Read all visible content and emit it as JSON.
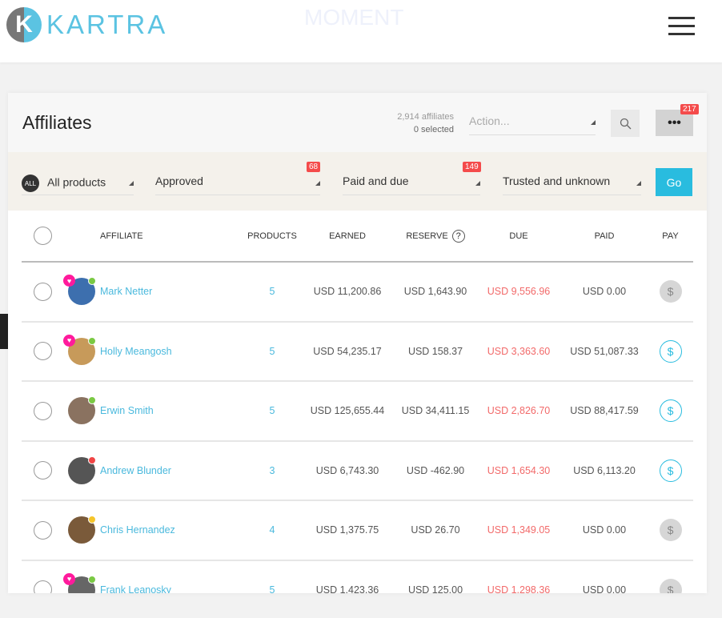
{
  "brand": {
    "logo_letter": "K",
    "logo_text": "KARTRA",
    "moment": "MOMENT"
  },
  "header": {
    "title": "Affiliates",
    "affiliate_count": "2,914 affiliates",
    "selected_count": "0 selected",
    "action_placeholder": "Action...",
    "more_label": "•••",
    "more_badge": "217"
  },
  "filters": {
    "all_badge": "ALL",
    "products": "All products",
    "status": "Approved",
    "status_badge": "68",
    "payment": "Paid and due",
    "payment_badge": "149",
    "trust": "Trusted and unknown",
    "go": "Go"
  },
  "table": {
    "columns": [
      "AFFILIATE",
      "PRODUCTS",
      "EARNED",
      "RESERVE",
      "DUE",
      "PAID",
      "PAY"
    ],
    "reserve_help": "?",
    "rows": [
      {
        "name": "Mark Netter",
        "products": "5",
        "earned": "USD 11,200.86",
        "reserve": "USD 1,643.90",
        "due": "USD 9,556.96",
        "paid": "USD 0.00",
        "pay_enabled": false,
        "heart": true,
        "status": "#7ac943",
        "avatar": "#3d6fae"
      },
      {
        "name": "Holly Meangosh",
        "products": "5",
        "earned": "USD 54,235.17",
        "reserve": "USD 158.37",
        "due": "USD 3,363.60",
        "paid": "USD 51,087.33",
        "pay_enabled": true,
        "heart": true,
        "status": "#7ac943",
        "avatar": "#c79a5a"
      },
      {
        "name": "Erwin Smith",
        "products": "5",
        "earned": "USD 125,655.44",
        "reserve": "USD 34,411.15",
        "due": "USD 2,826.70",
        "paid": "USD 88,417.59",
        "pay_enabled": true,
        "heart": false,
        "status": "#7ac943",
        "avatar": "#8a7260"
      },
      {
        "name": "Andrew Blunder",
        "products": "3",
        "earned": "USD 6,743.30",
        "reserve": "USD -462.90",
        "due": "USD 1,654.30",
        "paid": "USD 6,113.20",
        "pay_enabled": true,
        "heart": false,
        "status": "#f04545",
        "avatar": "#555"
      },
      {
        "name": "Chris Hernandez",
        "products": "4",
        "earned": "USD 1,375.75",
        "reserve": "USD 26.70",
        "due": "USD 1,349.05",
        "paid": "USD 0.00",
        "pay_enabled": false,
        "heart": false,
        "status": "#f5c52a",
        "avatar": "#7a5a3a"
      },
      {
        "name": "Frank Leanosky",
        "products": "5",
        "earned": "USD 1,423.36",
        "reserve": "USD 125.00",
        "due": "USD 1,298.36",
        "paid": "USD 0.00",
        "pay_enabled": false,
        "heart": true,
        "status": "#7ac943",
        "avatar": "#666"
      }
    ]
  }
}
